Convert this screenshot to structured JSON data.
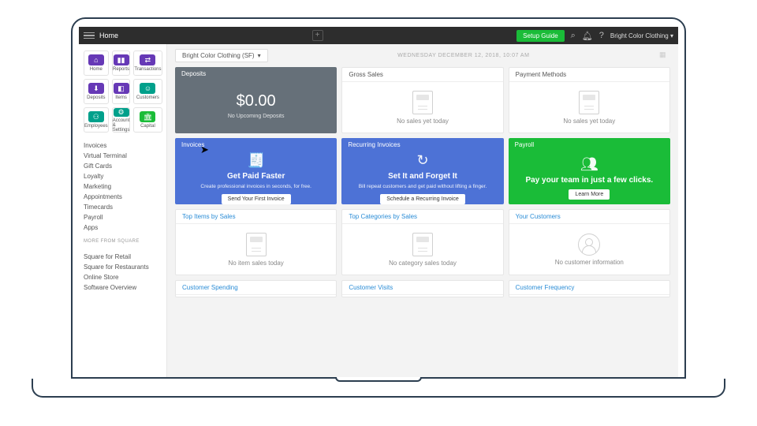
{
  "topbar": {
    "title": "Home",
    "setup": "Setup Guide",
    "account": "Bright Color Clothing"
  },
  "sidebar": {
    "tiles": [
      {
        "label": "Home",
        "icon": "home-icon"
      },
      {
        "label": "Reports",
        "icon": "reports-icon"
      },
      {
        "label": "Transactions",
        "icon": "transactions-icon"
      },
      {
        "label": "Deposits",
        "icon": "deposits-icon"
      },
      {
        "label": "Items",
        "icon": "items-icon"
      },
      {
        "label": "Customers",
        "icon": "customers-icon"
      },
      {
        "label": "Employees",
        "icon": "employees-icon"
      },
      {
        "label": "Account & Settings",
        "icon": "settings-icon"
      },
      {
        "label": "Capital",
        "icon": "capital-icon"
      }
    ],
    "links": [
      "Invoices",
      "Virtual Terminal",
      "Gift Cards",
      "Loyalty",
      "Marketing",
      "Appointments",
      "Timecards",
      "Payroll",
      "Apps"
    ],
    "more_heading": "MORE FROM SQUARE",
    "more": [
      "Square for Retail",
      "Square for Restaurants",
      "Online Store",
      "Software Overview"
    ]
  },
  "main": {
    "location": "Bright Color Clothing (SF)",
    "date": "WEDNESDAY DECEMBER 12, 2018, 10:07 AM",
    "deposits": {
      "title": "Deposits",
      "amount": "$0.00",
      "sub": "No Upcoming Deposits"
    },
    "gross": {
      "title": "Gross Sales",
      "msg": "No sales yet today"
    },
    "payment": {
      "title": "Payment Methods",
      "msg": "No sales yet today"
    },
    "invoices": {
      "title": "Invoices",
      "heading": "Get Paid Faster",
      "text": "Create professional invoices in seconds, for free.",
      "button": "Send Your First Invoice"
    },
    "recurring": {
      "title": "Recurring Invoices",
      "heading": "Set It and Forget It",
      "text": "Bill repeat customers and get paid without lifting a finger.",
      "button": "Schedule a Recurring Invoice"
    },
    "payroll": {
      "title": "Payroll",
      "heading": "Pay your team in just a few clicks.",
      "button": "Learn More"
    },
    "topitems": {
      "title": "Top Items by Sales",
      "msg": "No item sales today"
    },
    "topcats": {
      "title": "Top Categories by Sales",
      "msg": "No category sales today"
    },
    "customers": {
      "title": "Your Customers",
      "msg": "No customer information"
    },
    "row4": {
      "spending": "Customer Spending",
      "visits": "Customer Visits",
      "freq": "Customer Frequency"
    }
  }
}
